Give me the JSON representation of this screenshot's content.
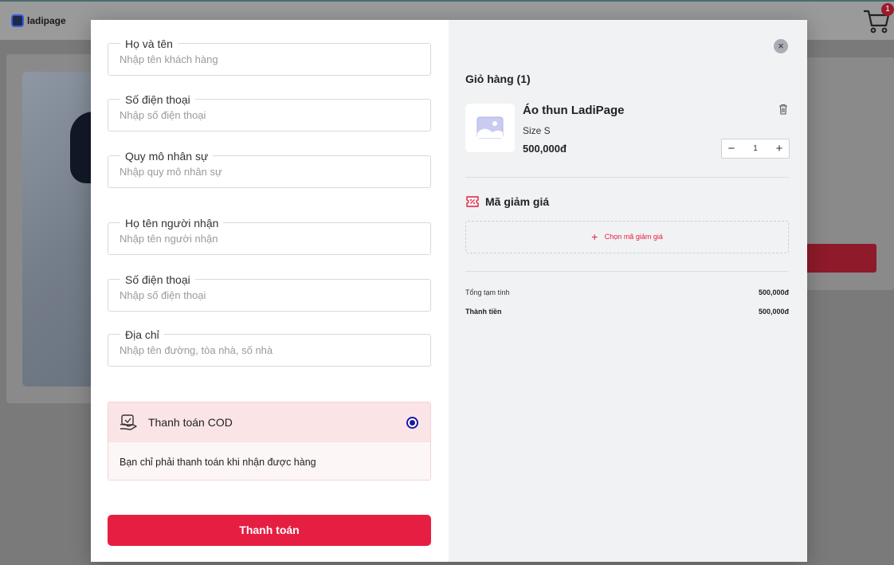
{
  "background": {
    "logo_text": "ladipage",
    "cart_badge": "1"
  },
  "form": {
    "fields": [
      {
        "label": "Họ và tên",
        "placeholder": "Nhập tên khách hàng",
        "value": ""
      },
      {
        "label": "Số điện thoại",
        "placeholder": "Nhập số điện thoại",
        "value": ""
      },
      {
        "label": "Quy mô nhân sự",
        "placeholder": "Nhập quy mô nhân sự",
        "value": ""
      },
      {
        "label": "Họ tên người nhận",
        "placeholder": "Nhập tên người nhận",
        "value": ""
      },
      {
        "label": "Số điện thoại",
        "placeholder": "Nhập số điện thoại",
        "value": ""
      },
      {
        "label": "Địa chỉ",
        "placeholder": "Nhập tên đường, tòa nhà, số nhà",
        "value": ""
      }
    ],
    "payment": {
      "title": "Thanh toán COD",
      "description": "Bạn chỉ phải thanh toán khi nhận được hàng",
      "selected": true
    },
    "submit_label": "Thanh toán"
  },
  "cart": {
    "title": "Giỏ hàng (1)",
    "close_label": "×",
    "product": {
      "name": "Áo thun LadiPage",
      "variant": "Size S",
      "price": "500,000đ",
      "quantity": "1"
    },
    "qty_minus": "−",
    "qty_plus": "+",
    "coupon": {
      "title": "Mã giảm giá",
      "choose_label": "Chọn mã giảm giá",
      "plus": "+"
    },
    "summary": {
      "subtotal_label": "Tổng tạm tính",
      "subtotal_value": "500,000đ",
      "total_label": "Thành tiền",
      "total_value": "500,000đ"
    }
  },
  "colors": {
    "accent": "#e61e42",
    "radio": "#1a1aa6",
    "cart_bg": "#f1f2f4"
  }
}
